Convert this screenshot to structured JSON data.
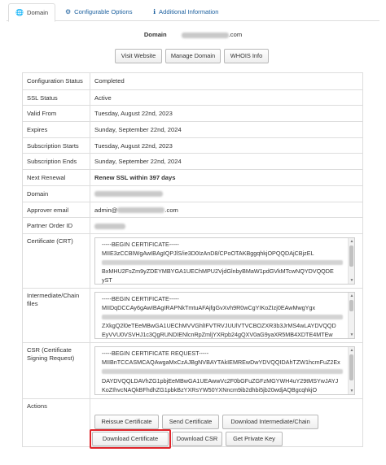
{
  "tabs": [
    {
      "label": "Domain",
      "icon": "globe-icon"
    },
    {
      "label": "Configurable Options",
      "icon": "cogs-icon"
    },
    {
      "label": "Additional Information",
      "icon": "info-icon"
    }
  ],
  "domain_header": {
    "label": "Domain",
    "value_suffix": ".com"
  },
  "domain_buttons": [
    "Visit Website",
    "Manage Domain",
    "WHOIS Info"
  ],
  "details": [
    {
      "label": "Configuration Status",
      "value": "Completed"
    },
    {
      "label": "SSL Status",
      "value": "Active"
    },
    {
      "label": "Valid From",
      "value": "Tuesday, August 22nd, 2023"
    },
    {
      "label": "Expires",
      "value": "Sunday, September 22nd, 2024"
    },
    {
      "label": "Subscription Starts",
      "value": "Tuesday, August 22nd, 2023"
    },
    {
      "label": "Subscription Ends",
      "value": "Sunday, September 22nd, 2024"
    },
    {
      "label": "Next Renewal",
      "value": "Renew SSL within 397 days"
    },
    {
      "label": "Domain",
      "value": ""
    },
    {
      "label": "Approver email",
      "value_prefix": "admin@",
      "value_suffix": ".com"
    },
    {
      "label": "Partner Order ID",
      "value": ""
    }
  ],
  "certificate": {
    "label": "Certificate (CRT)",
    "lines": [
      "-----BEGIN CERTIFICATE-----",
      "MIIE3zCCBIWgAwIBAgIQPJlS/ie3D0IzAnD8/CPoOTAKBggqhkjOPQQDAjCBjzEL",
      "",
      "BxMHU2FsZm9yZDEYMBYGA1UEChMPU2VjdGlnbyBMaW1pdGVkMTcwNQYDVQQDE",
      "yST"
    ]
  },
  "intermediate": {
    "label": "Intermediate/Chain files",
    "lines": [
      "-----BEGIN CERTIFICATE-----",
      "MIIDqDCCAy6gAwIBAgIRAPNkTmtuAFAjfgGvXvh9R0wCgYIKoZIzj0EAwMwgYgx",
      "",
      "ZXkgQ2l0eTEeMBwGA1UEChMVVGhlIFVTRVJUUlVTVCBOZXR3b3JrMS4wLAYDVQQD",
      "EyVVU0VSVHJ1c3QgRUNDIENlcnRpZmljYXRpb24gQXV0aG9yaXR5MB4XDTE4MTEw"
    ]
  },
  "csr": {
    "label": "CSR (Certificate Signing Request)",
    "lines": [
      "-----BEGIN CERTIFICATE REQUEST-----",
      "MIIBnTCCASMCAQAwgaMxCzAJBgNVBAYTAkIEMREwDwYDVQQIDAhTZW1hcmFuZ2Ex",
      "",
      "DAYDVQQLDAVhZG1pbjEeMBwGA1UEAwwVc2F0bGFuZGFzMGYWH4uY29tMSYwJAYJ",
      "KoZIhvcNAQkBFhdhZG1pbkBzYXRsYW50YXNncm9ib2dhbi5jb20wdjAQBgcqhkjO"
    ]
  },
  "actions": {
    "label": "Actions",
    "row1": [
      "Reissue Certificate",
      "Send Certificate",
      "Download Intermediate/Chain"
    ],
    "row2": [
      "Download Certificate",
      "Download CSR",
      "Get Private Key"
    ]
  },
  "colors": {
    "tab_link": "#1a5f9e",
    "highlight": "#e0252b",
    "border": "#dddddd"
  }
}
